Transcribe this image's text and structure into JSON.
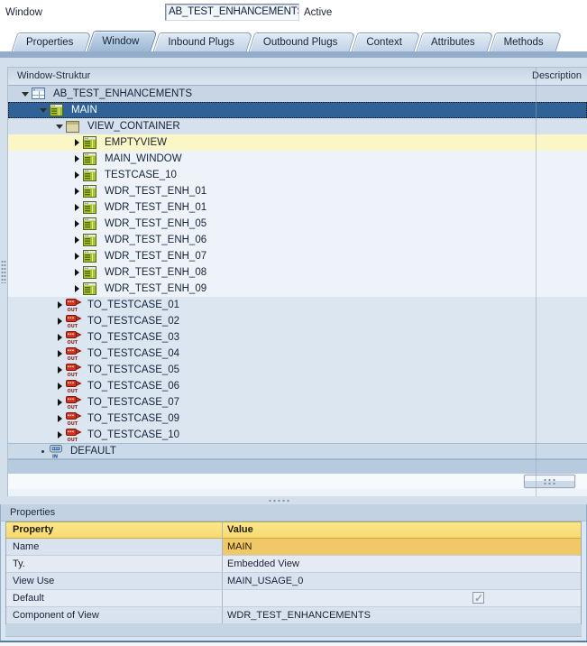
{
  "header": {
    "label": "Window",
    "value": "AB_TEST_ENHANCEMENTS",
    "status": "Active"
  },
  "tabs": [
    {
      "label": "Properties",
      "active": false
    },
    {
      "label": "Window",
      "active": true
    },
    {
      "label": "Inbound Plugs",
      "active": false
    },
    {
      "label": "Outbound Plugs",
      "active": false
    },
    {
      "label": "Context",
      "active": false
    },
    {
      "label": "Attributes",
      "active": false
    },
    {
      "label": "Methods",
      "active": false
    }
  ],
  "tree": {
    "header_col1": "Window-Struktur",
    "header_col2": "Description",
    "nodes": [
      {
        "label": "AB_TEST_ENHANCEMENTS",
        "level": 0,
        "icon": "window-icon",
        "exp": "open",
        "bg": "root"
      },
      {
        "label": "MAIN",
        "level": 1,
        "icon": "view-icon",
        "exp": "open",
        "bg": "sel",
        "selected": true
      },
      {
        "label": "VIEW_CONTAINER",
        "level": 2,
        "icon": "view-container-icon",
        "exp": "open",
        "bg": "container"
      },
      {
        "label": "EMPTYVIEW",
        "level": 3,
        "icon": "view-icon",
        "exp": "closed",
        "bg": "hl"
      },
      {
        "label": "MAIN_WINDOW",
        "level": 3,
        "icon": "view-icon",
        "exp": "closed",
        "bg": "light"
      },
      {
        "label": "TESTCASE_10",
        "level": 3,
        "icon": "view-icon",
        "exp": "closed",
        "bg": "light"
      },
      {
        "label": "WDR_TEST_ENH_01",
        "level": 3,
        "icon": "view-icon",
        "exp": "closed",
        "bg": "light"
      },
      {
        "label": "WDR_TEST_ENH_01",
        "level": 3,
        "icon": "view-icon",
        "exp": "closed",
        "bg": "light"
      },
      {
        "label": "WDR_TEST_ENH_05",
        "level": 3,
        "icon": "view-icon",
        "exp": "closed",
        "bg": "light"
      },
      {
        "label": "WDR_TEST_ENH_06",
        "level": 3,
        "icon": "view-icon",
        "exp": "closed",
        "bg": "light"
      },
      {
        "label": "WDR_TEST_ENH_07",
        "level": 3,
        "icon": "view-icon",
        "exp": "closed",
        "bg": "light"
      },
      {
        "label": "WDR_TEST_ENH_08",
        "level": 3,
        "icon": "view-icon",
        "exp": "closed",
        "bg": "light"
      },
      {
        "label": "WDR_TEST_ENH_09",
        "level": 3,
        "icon": "view-icon",
        "exp": "closed",
        "bg": "light"
      },
      {
        "label": "TO_TESTCASE_01",
        "level": 2,
        "icon": "outbound-plug-icon",
        "exp": "closed",
        "bg": "mid"
      },
      {
        "label": "TO_TESTCASE_02",
        "level": 2,
        "icon": "outbound-plug-icon",
        "exp": "closed",
        "bg": "mid"
      },
      {
        "label": "TO_TESTCASE_03",
        "level": 2,
        "icon": "outbound-plug-icon",
        "exp": "closed",
        "bg": "mid"
      },
      {
        "label": "TO_TESTCASE_04",
        "level": 2,
        "icon": "outbound-plug-icon",
        "exp": "closed",
        "bg": "mid"
      },
      {
        "label": "TO_TESTCASE_05",
        "level": 2,
        "icon": "outbound-plug-icon",
        "exp": "closed",
        "bg": "mid"
      },
      {
        "label": "TO_TESTCASE_06",
        "level": 2,
        "icon": "outbound-plug-icon",
        "exp": "closed",
        "bg": "mid"
      },
      {
        "label": "TO_TESTCASE_07",
        "level": 2,
        "icon": "outbound-plug-icon",
        "exp": "closed",
        "bg": "mid"
      },
      {
        "label": "TO_TESTCASE_09",
        "level": 2,
        "icon": "outbound-plug-icon",
        "exp": "closed",
        "bg": "mid"
      },
      {
        "label": "TO_TESTCASE_10",
        "level": 2,
        "icon": "outbound-plug-icon",
        "exp": "closed",
        "bg": "mid"
      },
      {
        "label": "DEFAULT",
        "level": 1,
        "icon": "inbound-plug-icon",
        "exp": "leaf",
        "bg": "default"
      }
    ]
  },
  "properties_panel": {
    "title": "Properties",
    "columns": [
      "Property",
      "Value"
    ],
    "rows": [
      {
        "property": "Name",
        "value": "MAIN",
        "highlight": true
      },
      {
        "property": "Ty.",
        "value": "Embedded View"
      },
      {
        "property": "View Use",
        "value": "MAIN_USAGE_0"
      },
      {
        "property": "Default",
        "value": "",
        "checkbox": true,
        "checked": true
      },
      {
        "property": "Component of View",
        "value": "WDR_TEST_ENHANCEMENTS"
      }
    ]
  },
  "colors": {
    "selection_blue": "#2f6397",
    "highlight_yellow": "#fbf6c6",
    "table_header_yellow": "#f9dd76",
    "value_highlight_amber": "#f1c868",
    "panel_blue": "#d4dfec",
    "tab_active_blue": "#9cb8d6"
  }
}
